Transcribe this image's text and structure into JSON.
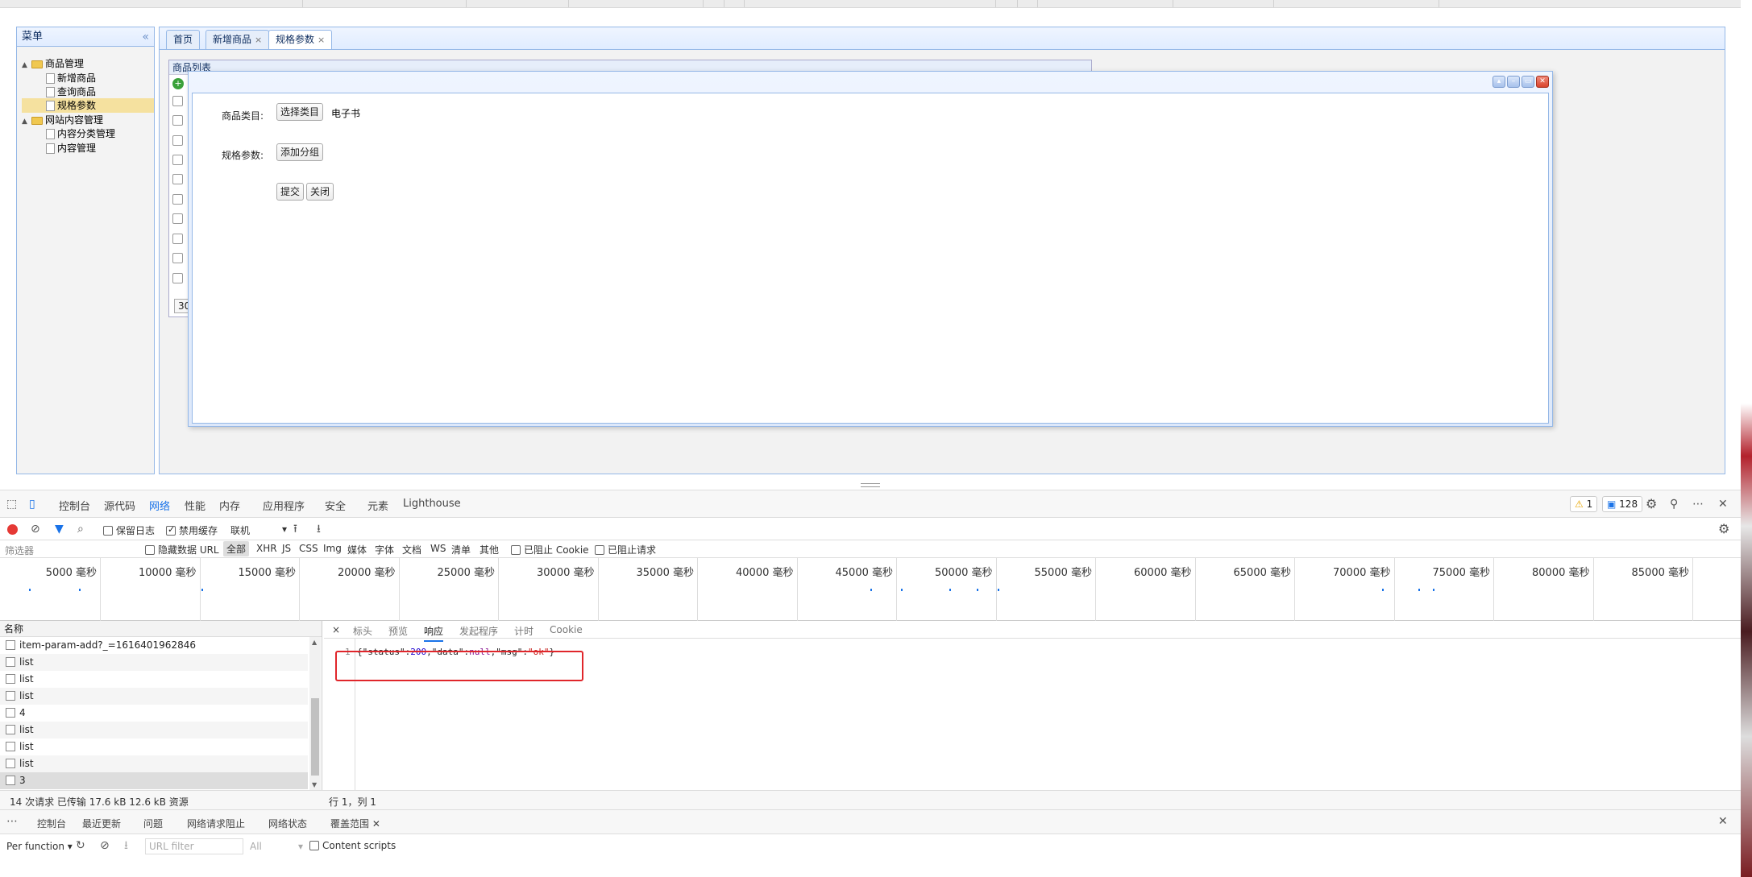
{
  "admin": {
    "menu_title": "菜单",
    "collapse_glyph": "«",
    "tree": [
      {
        "label": "商品管理",
        "type": "folder"
      },
      {
        "label": "新增商品",
        "type": "file"
      },
      {
        "label": "查询商品",
        "type": "file"
      },
      {
        "label": "规格参数",
        "type": "file",
        "selected": true
      },
      {
        "label": "网站内容管理",
        "type": "folder"
      },
      {
        "label": "内容分类管理",
        "type": "file"
      },
      {
        "label": "内容管理",
        "type": "file"
      }
    ],
    "tabs": [
      {
        "label": "首页",
        "closable": false
      },
      {
        "label": "新增商品",
        "closable": true
      },
      {
        "label": "规格参数",
        "closable": true,
        "active": true
      }
    ],
    "tab_close_glyph": "×",
    "list_panel_title": "商品列表",
    "pager_value": "30"
  },
  "dialog": {
    "category_label": "商品类目:",
    "select_category_button": "选择类目",
    "selected_category": "电子书",
    "spec_label": "规格参数:",
    "add_group_button": "添加分组",
    "submit_button": "提交",
    "close_button": "关闭"
  },
  "devtools": {
    "tabs": [
      "控制台",
      "源代码",
      "网络",
      "性能",
      "内存",
      "应用程序",
      "安全",
      "元素",
      "Lighthouse"
    ],
    "active_tab": "网络",
    "warnings_count": "1",
    "messages_count": "128",
    "toolbar": {
      "preserve_log": "保留日志",
      "disable_cache": "禁用缓存",
      "throttle": "联机"
    },
    "filter": {
      "placeholder": "筛选器",
      "hide_data_urls": "隐藏数据 URL",
      "types": [
        "全部",
        "XHR",
        "JS",
        "CSS",
        "Img",
        "媒体",
        "字体",
        "文档",
        "WS",
        "清单",
        "其他"
      ],
      "blocked_cookies": "已阻止 Cookie",
      "blocked_requests": "已阻止请求"
    },
    "timeline_ticks": [
      "5000 毫秒",
      "10000 毫秒",
      "15000 毫秒",
      "20000 毫秒",
      "25000 毫秒",
      "30000 毫秒",
      "35000 毫秒",
      "40000 毫秒",
      "45000 毫秒",
      "50000 毫秒",
      "55000 毫秒",
      "60000 毫秒",
      "65000 毫秒",
      "70000 毫秒",
      "75000 毫秒",
      "80000 毫秒",
      "85000 毫秒"
    ],
    "names_header": "名称",
    "requests": [
      "item-param-add?_=1616401962846",
      "list",
      "list",
      "list",
      "4",
      "list",
      "list",
      "list",
      "3"
    ],
    "detail_tabs": [
      "标头",
      "预览",
      "响应",
      "发起程序",
      "计时",
      "Cookie"
    ],
    "active_detail_tab": "响应",
    "detail_close": "×",
    "response_line_number": "1",
    "response": {
      "p1": "{\"status\":",
      "status": "200",
      "p2": ",\"data\":",
      "data": "null",
      "p3": ",\"msg\":",
      "msg": "\"ok\"",
      "p4": "}"
    },
    "summary": "14 次请求  已传输 17.6 kB  12.6 kB 资源",
    "cursor_position": "行 1，列 1",
    "drawer_tabs": [
      "控制台",
      "最近更新",
      "问题",
      "网络请求阻止",
      "网络状态",
      "覆盖范围"
    ],
    "active_drawer_tab": "覆盖范围",
    "coverage": {
      "per_function": "Per function",
      "url_filter_placeholder": "URL filter",
      "all": "All",
      "content_scripts": "Content scripts"
    }
  }
}
